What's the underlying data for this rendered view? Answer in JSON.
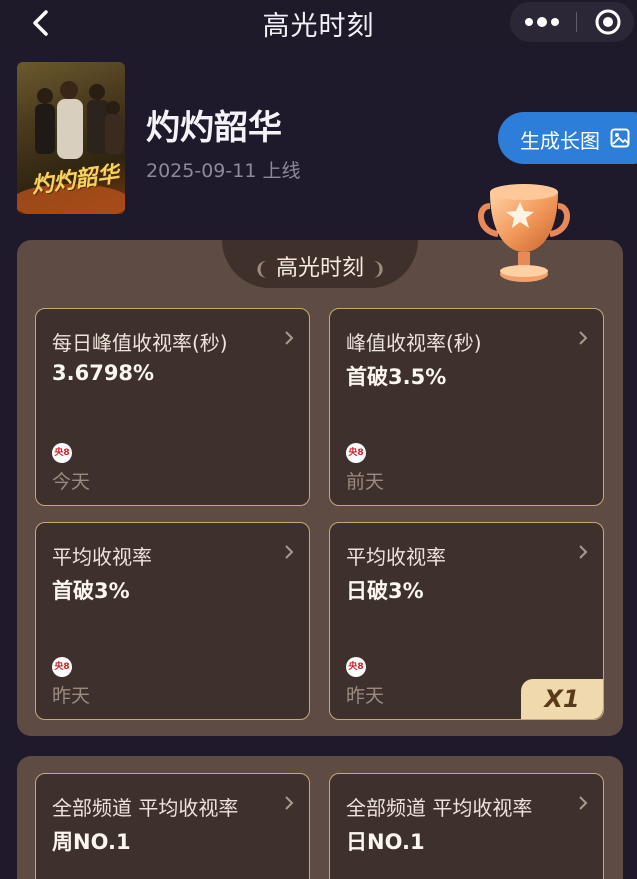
{
  "header": {
    "title": "高光时刻"
  },
  "show": {
    "poster_text": "灼灼韶华",
    "title": "灼灼韶华",
    "date": "2025-09-11 上线",
    "generate_label": "生成长图"
  },
  "section": {
    "title": "高光时刻"
  },
  "cards": [
    {
      "label": "每日峰值收视率(秒)",
      "value": "3.6798%",
      "channel": "央8",
      "day": "今天"
    },
    {
      "label": "峰值收视率(秒)",
      "value": "首破3.5%",
      "channel": "央8",
      "day": "前天"
    },
    {
      "label": "平均收视率",
      "value": "首破3%",
      "channel": "央8",
      "day": "昨天"
    },
    {
      "label": "平均收视率",
      "value": "日破3%",
      "channel": "央8",
      "day": "昨天",
      "badge": "X1"
    }
  ],
  "rank_cards": [
    {
      "label": "全部频道 平均收视率",
      "value": "周NO.1"
    },
    {
      "label": "全部频道 平均收视率",
      "value": "日NO.1"
    }
  ],
  "colors": {
    "accent": "#2d7ed8",
    "card_border": "#c9a67a",
    "panel": "#5e4c44",
    "background": "#1f1a2b"
  }
}
